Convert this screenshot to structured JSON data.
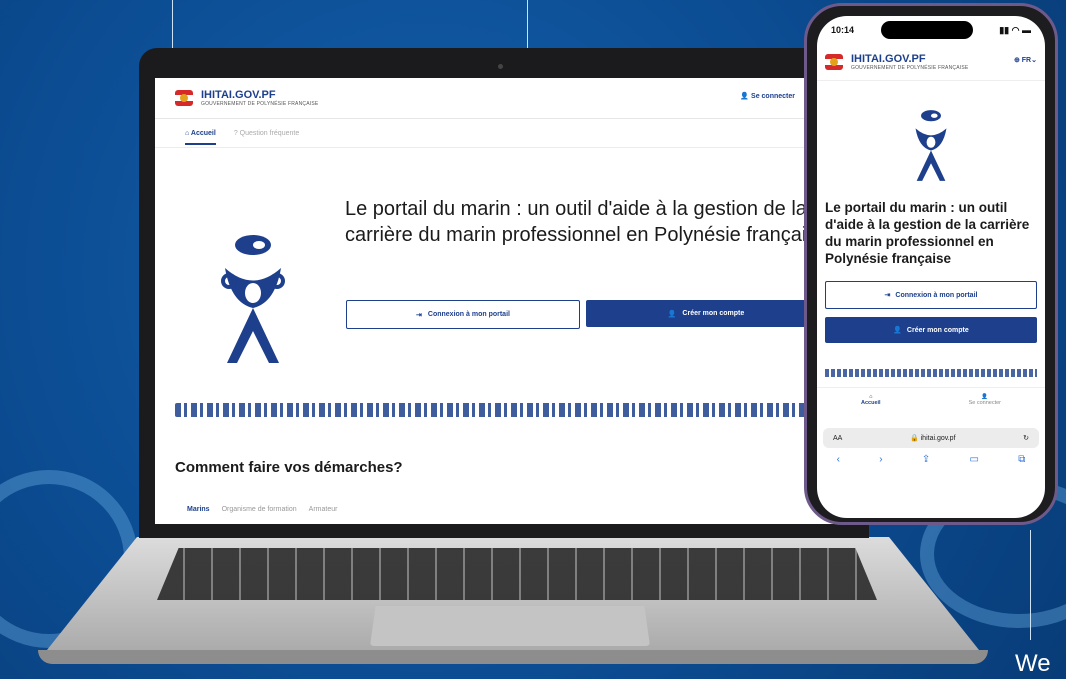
{
  "laptop": {
    "header": {
      "brand": "IHITAI.GOV.PF",
      "brand_subtitle": "GOUVERNEMENT DE POLYNÉSIE FRANÇAISE",
      "login": "Se connecter",
      "globe_icon": "globe-icon"
    },
    "tabs": [
      {
        "label": "Accueil",
        "active": true
      },
      {
        "label": "Question fréquente",
        "active": false
      }
    ],
    "hero": {
      "title": "Le portail du marin : un outil d'aide à la gestion de la carrière du marin professionnel en Polynésie française",
      "btn_login": "Connexion à mon portail",
      "btn_create": "Créer mon compte"
    },
    "section": {
      "title": "Comment faire vos démarches?",
      "subtabs": [
        "Marins",
        "Organisme de formation",
        "Armateur"
      ]
    }
  },
  "phone": {
    "status": {
      "time": "10:14"
    },
    "header": {
      "brand": "IHITAI.GOV.PF",
      "brand_subtitle": "GOUVERNEMENT DE POLYNÉSIE FRANÇAISE",
      "lang": "FR"
    },
    "hero": {
      "title": "Le portail du marin : un outil d'aide à la gestion de la carrière du marin professionnel en Polynésie française",
      "btn_login": "Connexion à mon portail",
      "btn_create": "Créer mon compte"
    },
    "nav": {
      "home": "Accueil",
      "login": "Se connecter"
    },
    "browser": {
      "aa": "AA",
      "url": "ihitai.gov.pf"
    }
  },
  "corner_text": "We",
  "colors": {
    "accent": "#1d3f8c",
    "background": "#0d4d93"
  }
}
